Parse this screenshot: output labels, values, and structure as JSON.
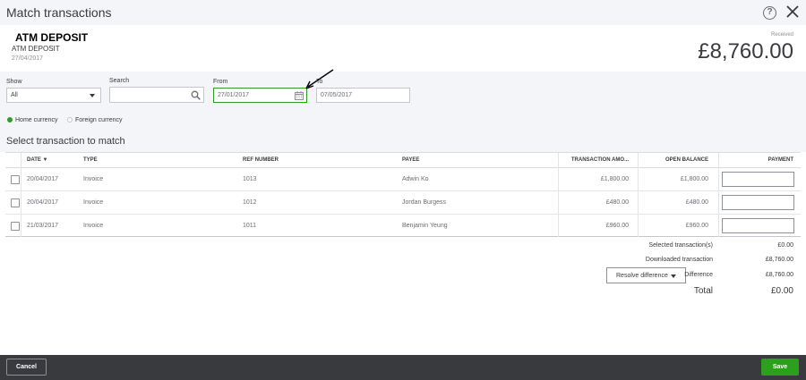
{
  "dialog": {
    "title": "Match transactions",
    "help_label": "?"
  },
  "transaction": {
    "name": "ATM DEPOSIT",
    "description": "ATM DEPOSIT",
    "date": "27/04/2017",
    "received_label": "Received",
    "received_amount": "£8,760.00"
  },
  "filters": {
    "show_label": "Show",
    "show_value": "All",
    "search_label": "Search",
    "search_value": "",
    "from_label": "From",
    "from_value": "27/01/2017",
    "to_label": "To",
    "to_value": "07/05/2017"
  },
  "currency": {
    "home": "Home currency",
    "foreign": "Foreign currency",
    "selected": "home"
  },
  "section_title": "Select transaction to match",
  "table": {
    "columns": [
      "DATE ▼",
      "TYPE",
      "REF NUMBER",
      "PAYEE",
      "TRANSACTION AMO...",
      "OPEN BALANCE",
      "PAYMENT"
    ],
    "rows": [
      {
        "date": "20/04/2017",
        "type": "Invoice",
        "ref": "1013",
        "payee": "Adwin Ko",
        "amount": "£1,800.00",
        "open": "£1,800.00",
        "payment": ""
      },
      {
        "date": "20/04/2017",
        "type": "Invoice",
        "ref": "1012",
        "payee": "Jordan Burgess",
        "amount": "£480.00",
        "open": "£480.00",
        "payment": ""
      },
      {
        "date": "21/03/2017",
        "type": "Invoice",
        "ref": "1011",
        "payee": "Benjamin Yeung",
        "amount": "£960.00",
        "open": "£960.00",
        "payment": ""
      }
    ]
  },
  "summary": {
    "selected_label": "Selected transaction(s)",
    "selected_value": "£0.00",
    "downloaded_label": "Downloaded transaction",
    "downloaded_value": "£8,760.00",
    "difference_label": "Difference",
    "difference_value": "£8,760.00",
    "resolve_label": "Resolve difference",
    "total_label": "Total",
    "total_value": "£0.00"
  },
  "footer": {
    "cancel_label": "Cancel",
    "save_label": "Save"
  },
  "colors": {
    "accent": "#2ca01c",
    "footer": "#393a3d",
    "panel": "#f4f5f8"
  },
  "icons": [
    "help-icon",
    "close-icon",
    "search-icon",
    "calendar-icon",
    "arrow-annotation-icon",
    "chevron-down-icon"
  ]
}
